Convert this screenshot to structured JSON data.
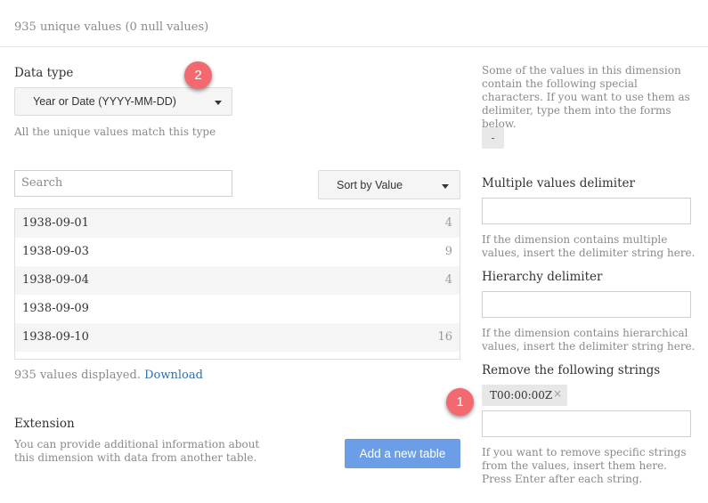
{
  "summary": "935 unique values (0 null values)",
  "data_type": {
    "label": "Data type",
    "selected": "Year or Date (YYYY-MM-DD)",
    "note": "All the unique values match this type"
  },
  "search": {
    "placeholder": "Search"
  },
  "sort": {
    "selected": "Sort by Value"
  },
  "values_list": [
    {
      "value": "1938-09-01",
      "count": "4"
    },
    {
      "value": "1938-09-03",
      "count": "9"
    },
    {
      "value": "1938-09-04",
      "count": "4"
    },
    {
      "value": "1938-09-09",
      "count": ""
    },
    {
      "value": "1938-09-10",
      "count": "16"
    }
  ],
  "footer": {
    "displayed": "935 values displayed.",
    "download": "Download"
  },
  "extension": {
    "title": "Extension",
    "description": "You can provide additional information about this dimension with data from another table.",
    "button": "Add a new table"
  },
  "special_chars": {
    "note": "Some of the values in this dimension contain the following special characters. If you want to use them as delimiter, type them into the forms below.",
    "char": "-"
  },
  "multiple_delimiter": {
    "label": "Multiple values delimiter",
    "value": "",
    "help": "If the dimension contains multiple values, insert the delimiter string here."
  },
  "hierarchy_delimiter": {
    "label": "Hierarchy delimiter",
    "value": "",
    "help": "If the dimension contains hierarchical values, insert the delimiter string here."
  },
  "remove_strings": {
    "label": "Remove the following strings",
    "tag": "T00:00:00Z",
    "tag_remove": "×",
    "value": "",
    "help": "If you want to remove specific strings from the values, insert them here. Press Enter after each string."
  },
  "badges": {
    "one": "1",
    "two": "2"
  },
  "colors": {
    "accent": "#6b9ee6",
    "badge": "#f26a6f",
    "link": "#2a6fb0"
  },
  "icons": {
    "dropdown": "caret-down-icon",
    "remove": "close-icon"
  }
}
